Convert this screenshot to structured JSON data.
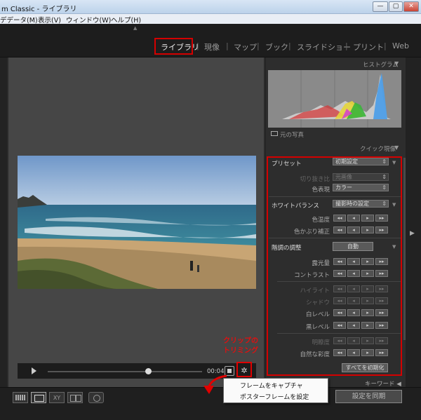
{
  "window": {
    "title": "m Classic - ライブラリ",
    "buttons": [
      "—",
      "▢",
      "✕"
    ]
  },
  "menu": [
    "デデータ(M)",
    "表示(V)",
    "ウィンドウ(W)",
    "ヘルプ(H)"
  ],
  "modules": [
    "ライブラリ",
    "現像",
    "マップ",
    "ブック",
    "スライドショー",
    "プリント",
    "Web"
  ],
  "active_module": "ライブラリ",
  "video": {
    "timecode": "00:04",
    "progress": 0.65
  },
  "annotation": {
    "clip_trim": "クリップの\nトリミング"
  },
  "histogram": {
    "header": "ヒストグラム",
    "original_photo": "元の写真"
  },
  "quick_develop": {
    "header": "クイック現像",
    "preset_label": "プリセット",
    "preset_value": "初期設定",
    "crop_label": "切り抜き比",
    "crop_value": "元画像",
    "color_label": "色表現",
    "color_value": "カラー",
    "wb_label": "ホワイトバランス",
    "wb_value": "撮影時の設定",
    "temp_label": "色温度",
    "tint_label": "色かぶり補正",
    "tone_label": "階調の調整",
    "auto_label": "自動",
    "exposure_label": "露光量",
    "contrast_label": "コントラスト",
    "highlight_label": "ハイライト",
    "shadow_label": "シャドウ",
    "white_label": "白レベル",
    "black_label": "黒レベル",
    "clarity_label": "明瞭度",
    "vibrance_label": "自然な彩度",
    "reset_label": "すべてを初期化",
    "step_buttons": [
      "◂◂",
      "◂",
      "▸",
      "▸▸"
    ]
  },
  "keyword": "キーワード",
  "sync_label": "設定を同期",
  "popup": {
    "capture": "フレームをキャプチャ",
    "poster": "ポスターフレームを設定"
  },
  "colors": {
    "highlight_red": "#d40000",
    "panel_bg": "#2d2d2d",
    "center_bg": "#464646"
  }
}
